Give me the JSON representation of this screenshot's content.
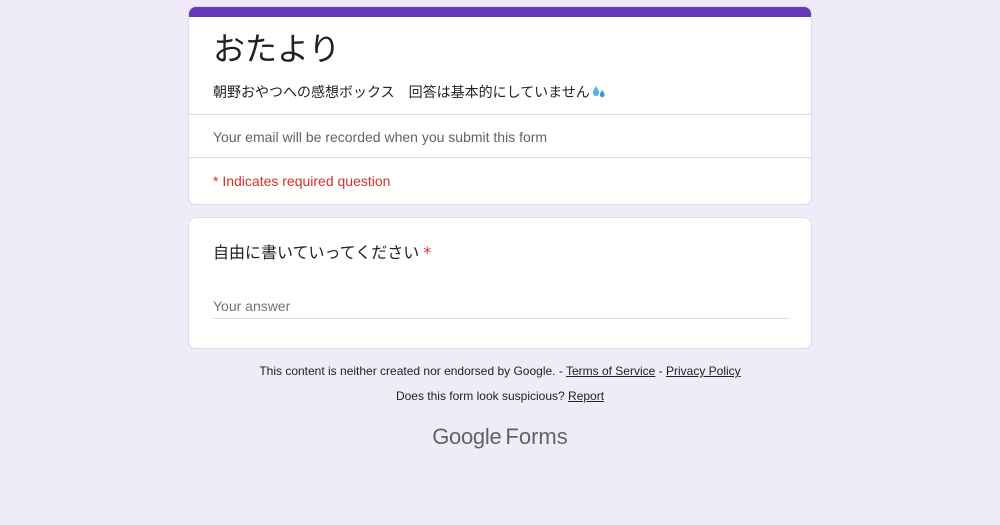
{
  "form": {
    "title": "おたより",
    "description": "朝野おやつへの感想ボックス　回答は基本的にしていません",
    "email_note": "Your email will be recorded when you submit this form",
    "required_note": "* Indicates required question",
    "accent_color": "#673ab7"
  },
  "question": {
    "title": "自由に書いていってください",
    "required_mark": "*",
    "answer_placeholder": "Your answer"
  },
  "footer": {
    "disclaimer": "This content is neither created nor endorsed by Google. -",
    "terms_label": "Terms of Service",
    "separator": "-",
    "privacy_label": "Privacy Policy",
    "suspicious_text": "Does this form look suspicious?",
    "report_label": "Report"
  },
  "brand": {
    "google": "Google",
    "forms": "Forms"
  },
  "icons": {
    "description_emoji": "sweat-droplets-icon"
  }
}
